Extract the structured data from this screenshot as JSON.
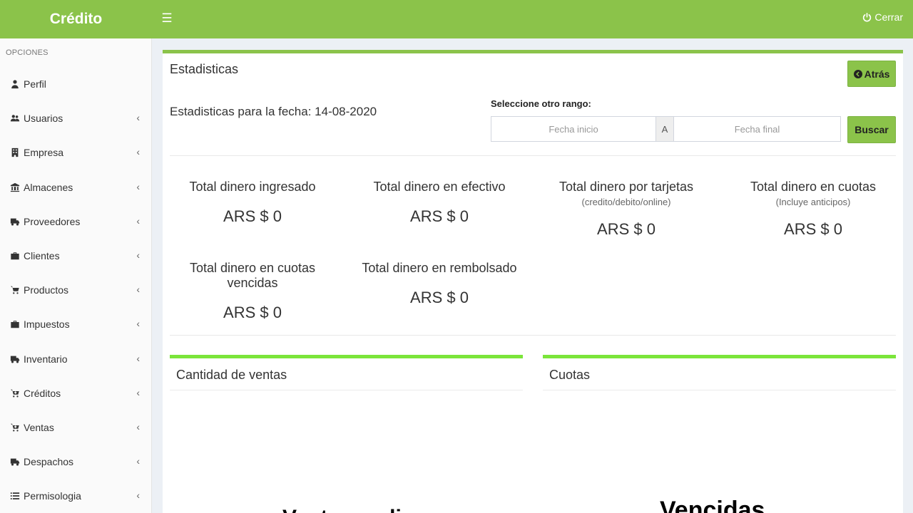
{
  "header": {
    "brand": "Crédito",
    "logout_label": "Cerrar"
  },
  "sidebar": {
    "section_label": "OPCIONES",
    "items": [
      {
        "label": "Perfil",
        "icon": "user-icon",
        "has_submenu": false
      },
      {
        "label": "Usuarios",
        "icon": "users-icon",
        "has_submenu": true
      },
      {
        "label": "Empresa",
        "icon": "building-icon",
        "has_submenu": true
      },
      {
        "label": "Almacenes",
        "icon": "bank-icon",
        "has_submenu": true
      },
      {
        "label": "Proveedores",
        "icon": "truck-icon",
        "has_submenu": true
      },
      {
        "label": "Clientes",
        "icon": "briefcase-icon",
        "has_submenu": true
      },
      {
        "label": "Productos",
        "icon": "cart-icon",
        "has_submenu": true
      },
      {
        "label": "Impuestos",
        "icon": "briefcase-icon",
        "has_submenu": true
      },
      {
        "label": "Inventario",
        "icon": "truck-icon",
        "has_submenu": true
      },
      {
        "label": "Créditos",
        "icon": "cart-plus-icon",
        "has_submenu": true
      },
      {
        "label": "Ventas",
        "icon": "cart-plus-icon",
        "has_submenu": true
      },
      {
        "label": "Despachos",
        "icon": "truck-icon",
        "has_submenu": true
      },
      {
        "label": "Permisologia",
        "icon": "list-icon",
        "has_submenu": true
      }
    ]
  },
  "main": {
    "title": "Estadisticas",
    "back_label": "Atrás",
    "date_text": "Estadisticas para la fecha: 14-08-2020",
    "range_label": "Seleccione otro rango:",
    "start_placeholder": "Fecha inicio",
    "separator": "A",
    "end_placeholder": "Fecha final",
    "search_label": "Buscar",
    "stats": [
      {
        "label": "Total dinero ingresado",
        "sub": "",
        "value": "ARS $ 0"
      },
      {
        "label": "Total dinero en efectivo",
        "sub": "",
        "value": "ARS $ 0"
      },
      {
        "label": "Total dinero por tarjetas",
        "sub": "(credito/debito/online)",
        "value": "ARS $ 0"
      },
      {
        "label": "Total dinero en cuotas",
        "sub": "(Incluye anticipos)",
        "value": "ARS $ 0"
      },
      {
        "label": "Total dinero en cuotas vencidas",
        "sub": "",
        "value": "ARS $ 0"
      },
      {
        "label": "Total dinero en rembolsado",
        "sub": "",
        "value": "ARS $ 0"
      }
    ],
    "panels": [
      {
        "title": "Cantidad de ventas",
        "chart_text": "Ventas realiz"
      },
      {
        "title": "Cuotas",
        "chart_text": "Vencidas"
      }
    ]
  },
  "colors": {
    "primary": "#8bc34a",
    "panel_accent": "#7be53a"
  }
}
